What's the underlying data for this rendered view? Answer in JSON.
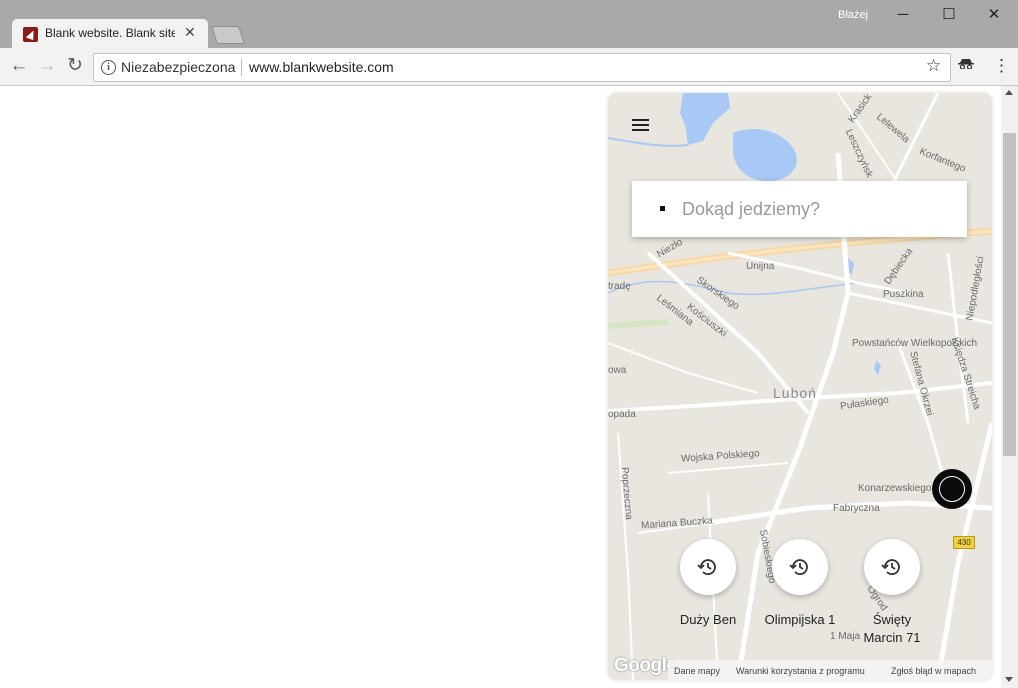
{
  "window": {
    "tab_title": "Blank website. Blank site",
    "user": "Błażej",
    "minimize": "─",
    "maximize": "☐",
    "close": "✕"
  },
  "toolbar": {
    "security_label": "Niezabezpieczona",
    "url": "www.blankwebsite.com"
  },
  "map": {
    "search_placeholder": "Dokąd jedziemy?",
    "recent_places": [
      {
        "label": "Duży Ben"
      },
      {
        "label": "Olimpijska 1"
      },
      {
        "label": "Święty Marcin 71"
      }
    ],
    "streets": {
      "town": "Luboń",
      "unijna": "Unijna",
      "puszkina": "Puszkina",
      "debiecka": "Dębiecka",
      "powstancow": "Powstańców Wielkopolskich",
      "pulaskiego": "Pułaskiego",
      "wojska": "Wojska Polskiego",
      "konarzewskiego": "Konarzewskiego",
      "fabryczna": "Fabryczna",
      "mariana": "Mariana Buczka",
      "kosciuszki": "Kościuszki",
      "lesmiana": "Leśmiana",
      "korfantego": "Korfantego",
      "lelewela": "Lelewela",
      "krasick": "Krasick",
      "leszczynsk": "Leszczyńsk",
      "niepodleglosci": "Niepodległości",
      "stefana": "Stefana Okrzei",
      "ksiedza": "Księdza Streicha",
      "sobieskiego": "Sobieskiego",
      "poprzeczna": "Poprzeczna",
      "ogrod": "Ogrod",
      "majowa": "1 Maja",
      "skorskiego": "Skorskiego",
      "opada": "opada",
      "owa": "owa",
      "trade": "tradę",
      "niezlo": "Niezło",
      "road_number": "430"
    },
    "attribution": {
      "google": "Google",
      "data": "Dane mapy",
      "terms": "Warunki korzystania z programu",
      "report": "Zgłoś błąd w mapach"
    }
  }
}
